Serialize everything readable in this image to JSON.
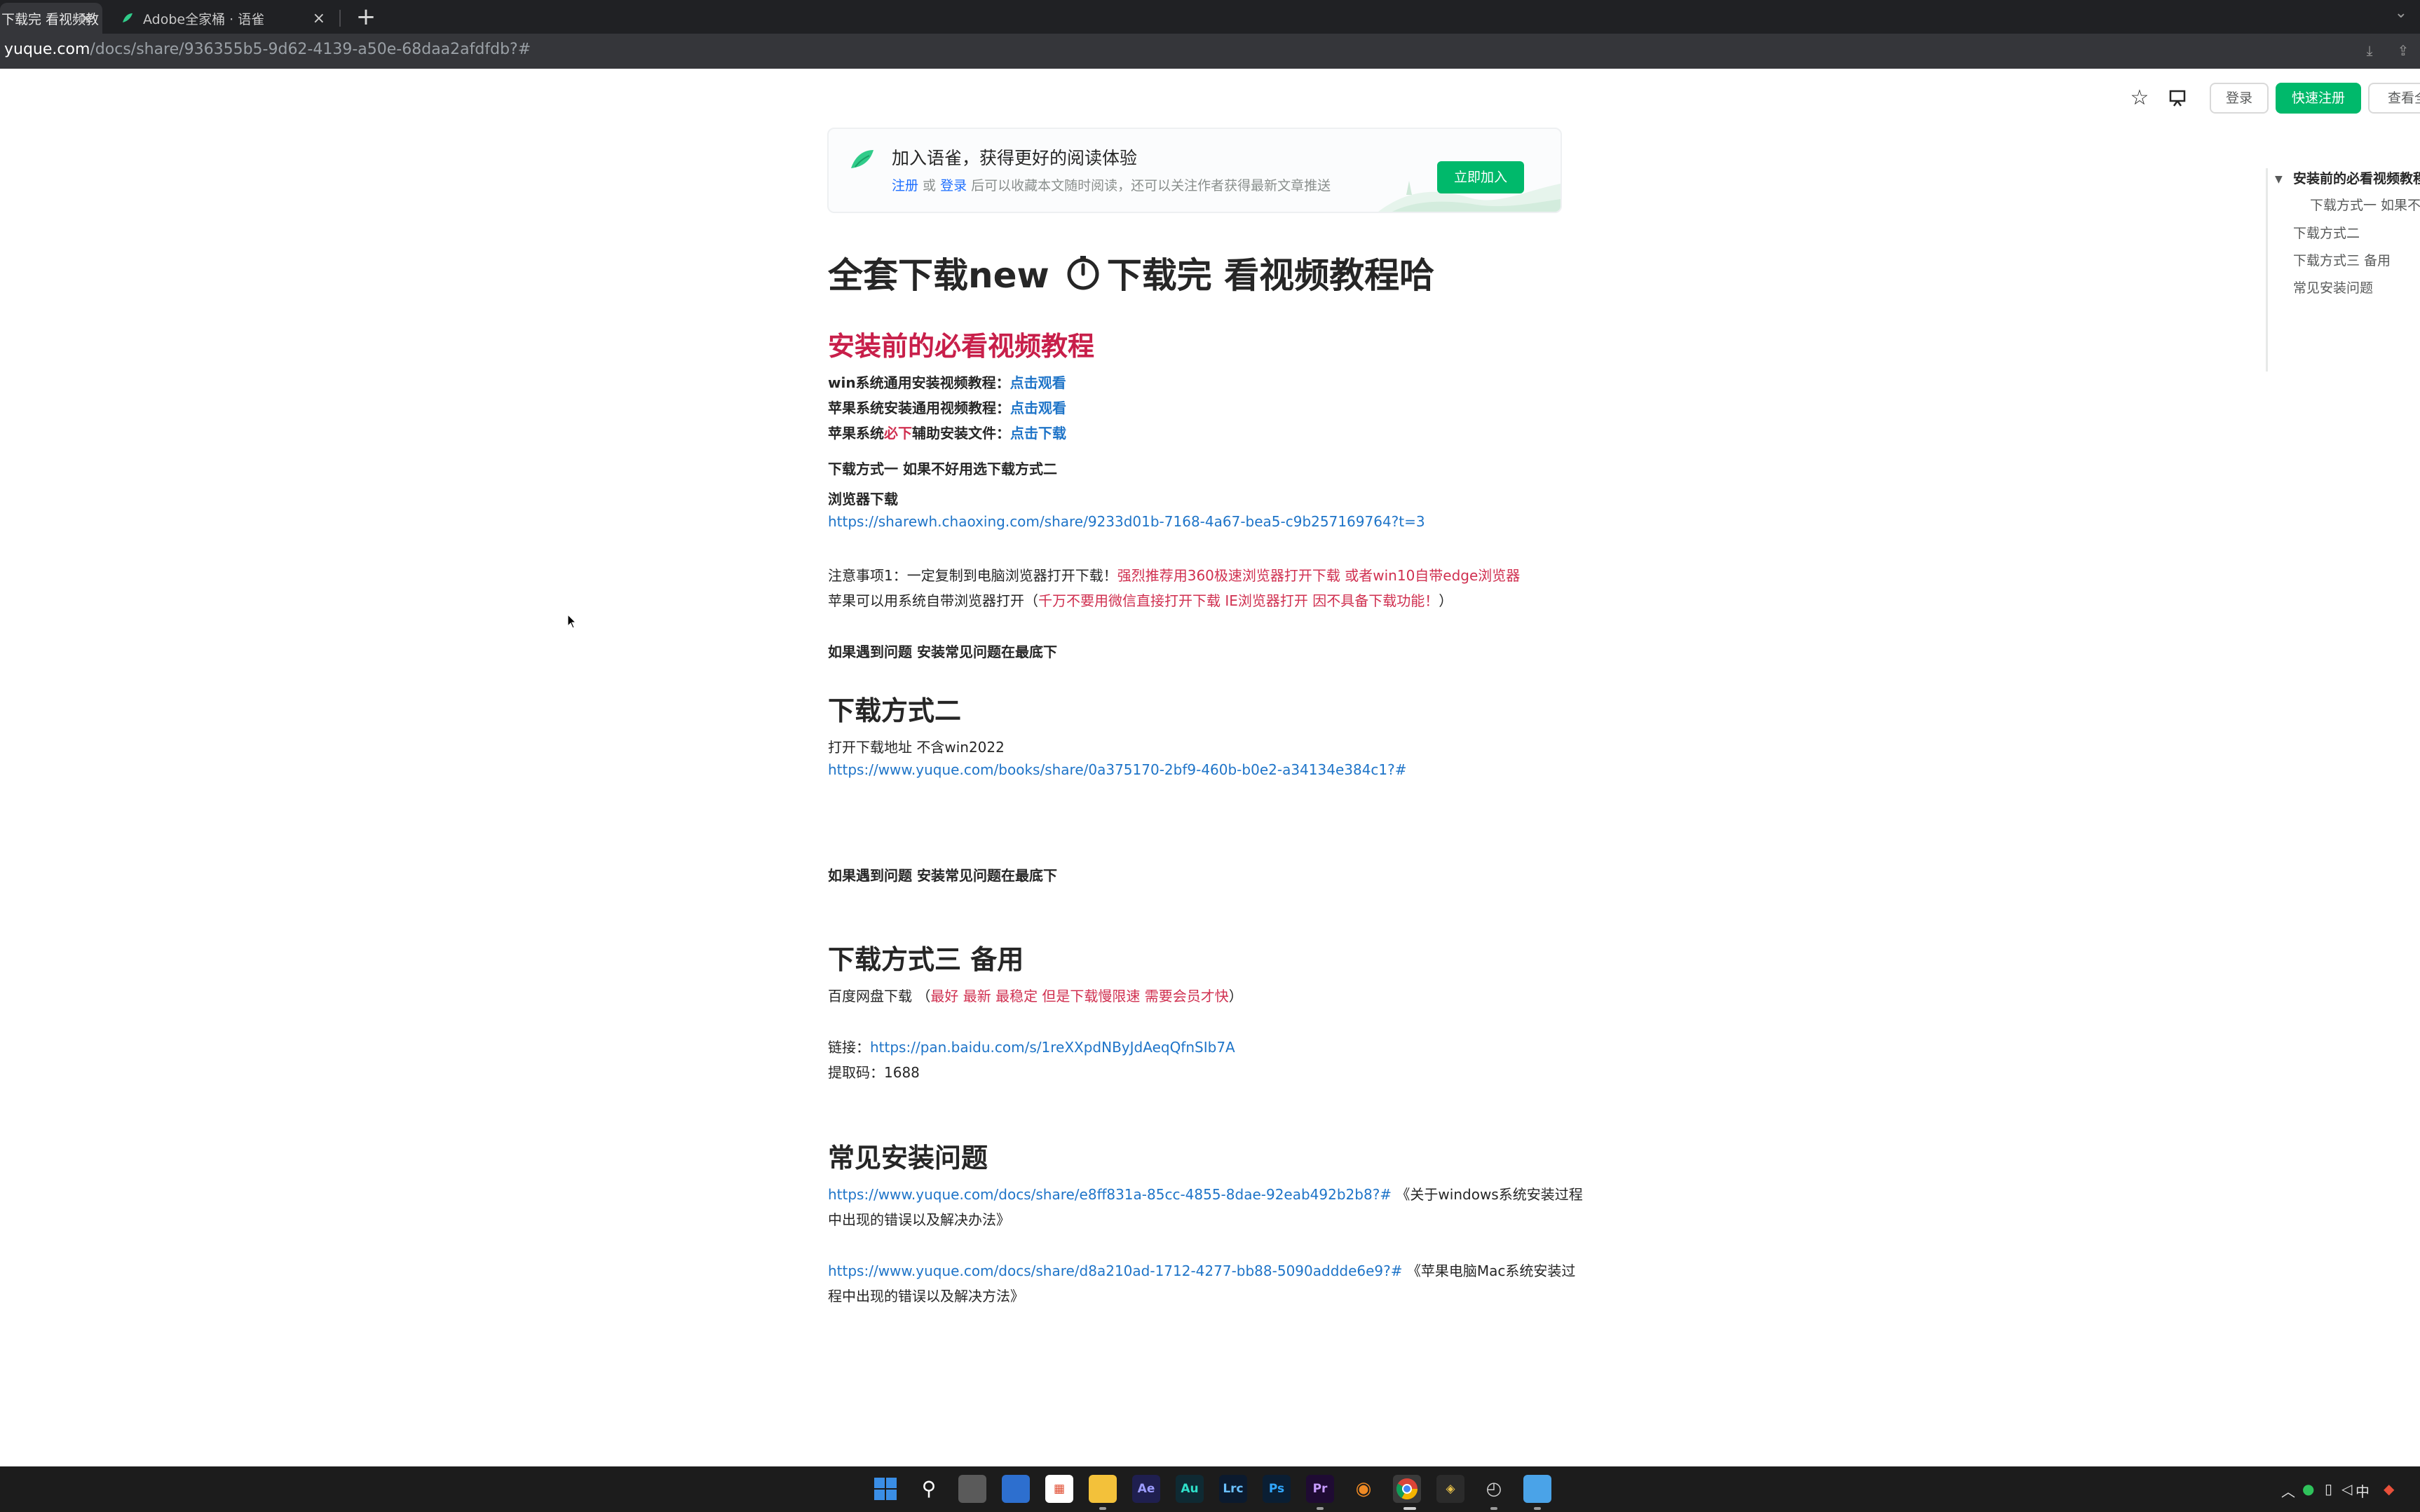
{
  "browser": {
    "tabs": [
      {
        "title": "下载完 看视频教",
        "active": true
      },
      {
        "title": "Adobe全家桶 · 语雀",
        "active": false
      }
    ],
    "new_tab_symbol": "+",
    "url_host": "yuque.com",
    "url_path": "/docs/share/936355b5-9d62-4139-a50e-68daa2afdfdb?#"
  },
  "header": {
    "login_label": "登录",
    "register_label": "快速注册",
    "more_label": "查看全部"
  },
  "banner": {
    "title": "加入语雀，获得更好的阅读体验",
    "register_link": "注册",
    "or_text": " 或 ",
    "login_link": "登录",
    "sub_text": " 后可以收藏本文随时阅读，还可以关注作者获得最新文章推送",
    "join_button": "立即加入"
  },
  "doc": {
    "title_part1": "全套下载new",
    "title_part2": "下载完 看视频教程哈",
    "section1": {
      "heading": "安装前的必看视频教程",
      "win_label": "win系统通用安装视频教程：",
      "win_link": "点击观看",
      "mac_label": "苹果系统安装通用视频教程：",
      "mac_link": "点击观看",
      "mac_file_prefix": "苹果系统",
      "mac_file_red": "必下",
      "mac_file_suffix": "辅助安装文件：",
      "mac_file_link": "点击下载"
    },
    "method1": {
      "heading": "下载方式一  如果不好用选下载方式二",
      "browser_label": "浏览器下载",
      "link": "https://sharewh.chaoxing.com/share/9233d01b-7168-4a67-bea5-c9b257169764?t=3",
      "note1_prefix": "注意事项1：一定复制到电脑浏览器打开下载！",
      "note1_red": "强烈推荐用360极速浏览器打开下载 或者win10自带edge浏览器",
      "note2_prefix": "苹果可以用系统自带浏览器打开（",
      "note2_red": "千万不要用微信直接打开下载 IE浏览器打开 因不具备下载功能！",
      "note2_suffix": "）",
      "problem": "如果遇到问题  安装常见问题在最底下"
    },
    "method2": {
      "heading": "下载方式二",
      "desc": "打开下载地址 不含win2022",
      "link": "https://www.yuque.com/books/share/0a375170-2bf9-460b-b0e2-a34134e384c1?#",
      "problem": "如果遇到问题  安装常见问题在最底下"
    },
    "method3": {
      "heading": "下载方式三 备用",
      "desc_prefix": "百度网盘下载 （",
      "desc_red": "最好 最新 最稳定  但是下载慢限速 需要会员才快",
      "desc_suffix": "）",
      "link_label": "链接：",
      "link": "https://pan.baidu.com/s/1reXXpdNByJdAeqQfnSIb7A",
      "code": "提取码：1688"
    },
    "faq": {
      "heading": "常见安装问题",
      "item1_link": "https://www.yuque.com/docs/share/e8ff831a-85cc-4855-8dae-92eab492b2b8?#",
      "item1_text_a": " 《关于windows系统安装过程",
      "item1_text_b": "中出现的错误以及解决办法》",
      "item2_link": "https://www.yuque.com/docs/share/d8a210ad-1712-4277-bb88-5090adddе6e9?#",
      "item2_text_a": " 《苹果电脑Mac系统安装过",
      "item2_text_b": "程中出现的错误以及解决方法》"
    }
  },
  "toc": {
    "items": [
      {
        "label": "安装前的必看视频教程",
        "active": true
      },
      {
        "label": "下载方式一 如果不好用选下载方式二",
        "active": false
      },
      {
        "label": "下载方式二",
        "active": false
      },
      {
        "label": "下载方式三 备用",
        "active": false
      },
      {
        "label": "常见安装问题",
        "active": false
      }
    ]
  },
  "taskbar": {
    "apps": [
      "start",
      "search",
      "task-view",
      "widgets",
      "store",
      "file-explorer",
      "Ae",
      "Au",
      "Lrc",
      "Ps",
      "Pr",
      "blender",
      "chrome",
      "davinci",
      "clock",
      "notepad"
    ],
    "ime": "中"
  },
  "colors": {
    "accent_green": "#00b96b",
    "heading_red": "#c81f4a",
    "link_blue": "#1e74c8",
    "note_red": "#d03050"
  }
}
